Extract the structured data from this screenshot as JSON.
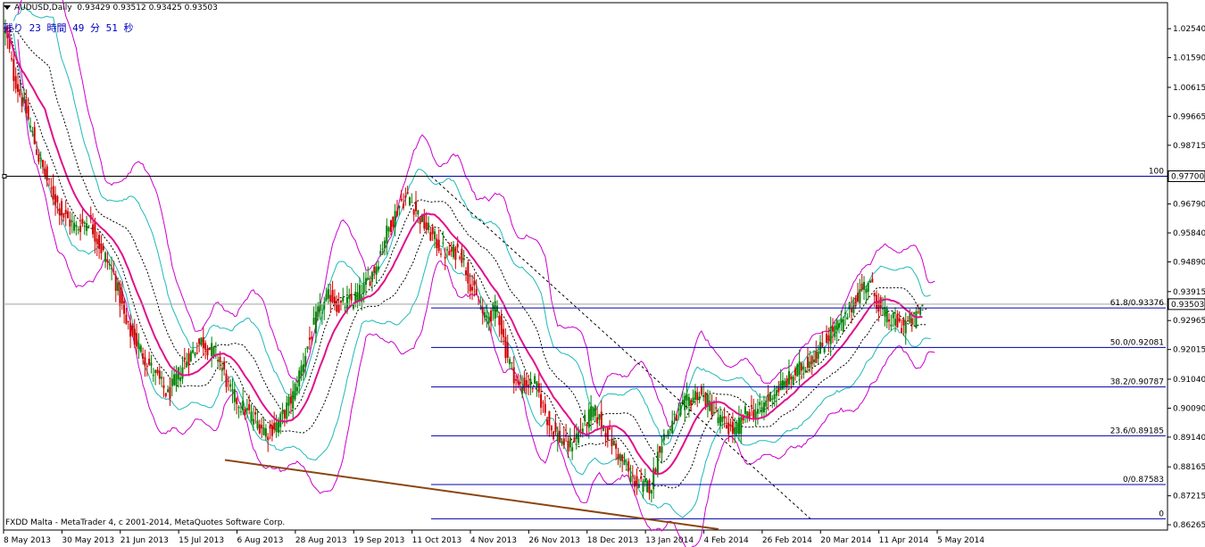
{
  "header": {
    "menu_icon": "triangle-down-icon",
    "symbol": "AUDUSD,Daily",
    "ohlc": "0.93429 0.93512 0.93425 0.93503",
    "timer": "残り 23 時間 49 分 51 秒"
  },
  "footer": {
    "copyright": "FXDD Malta - MetaTrader 4, c 2001-2014, MetaQuotes Software Corp."
  },
  "colors": {
    "background": "#ffffff",
    "bull_candle": "#008000",
    "bear_candle": "#d00000",
    "ma_line": "#e0108c",
    "outer_band": "#cc00cc",
    "inner_band": "#20b8b8",
    "envelope": "#000000",
    "fib_line": "#0000aa",
    "trendline": "#8b4513",
    "current_price": "#a0a0a0"
  },
  "chart_data": {
    "type": "candlestick",
    "symbol": "AUDUSD",
    "timeframe": "Daily",
    "last_price": 0.93503,
    "last_ohlc": {
      "open": 0.93429,
      "high": 0.93512,
      "low": 0.93425,
      "close": 0.93503
    },
    "y_range": [
      0.8615,
      1.0275
    ],
    "y_ticks": [
      "1.02540",
      "1.01590",
      "1.00615",
      "0.99665",
      "0.98715",
      "0.97700",
      "0.96790",
      "0.95840",
      "0.94890",
      "0.93915",
      "0.93503",
      "0.92965",
      "0.92015",
      "0.91040",
      "0.90090",
      "0.89140",
      "0.88165",
      "0.87215",
      "0.86265"
    ],
    "x_labels": [
      "8 May 2013",
      "30 May 2013",
      "21 Jun 2013",
      "15 Jul 2013",
      "6 Aug 2013",
      "28 Aug 2013",
      "19 Sep 2013",
      "11 Oct 2013",
      "4 Nov 2013",
      "26 Nov 2013",
      "18 Dec 2013",
      "13 Jan 2014",
      "4 Feb 2014",
      "26 Feb 2014",
      "20 Mar 2014",
      "11 Apr 2014",
      "5 May 2014"
    ],
    "horizontal_level": {
      "label": "0.97700",
      "value": 0.977
    },
    "fibonacci": [
      {
        "label": "100",
        "value": 0.977
      },
      {
        "label": "61.8/0.93376",
        "value": 0.93376
      },
      {
        "label": "50.0/0.92081",
        "value": 0.92081
      },
      {
        "label": "38.2/0.90787",
        "value": 0.90787
      },
      {
        "label": "23.6/0.89185",
        "value": 0.89185
      },
      {
        "label": "0/0.87583",
        "value": 0.87583
      },
      {
        "label": "0",
        "value": 0.8646
      }
    ],
    "close_keypoints": [
      [
        0,
        1.025
      ],
      [
        4,
        1.01
      ],
      [
        10,
        0.998
      ],
      [
        16,
        0.983
      ],
      [
        22,
        0.972
      ],
      [
        28,
        0.964
      ],
      [
        34,
        0.96
      ],
      [
        40,
        0.963
      ],
      [
        46,
        0.953
      ],
      [
        52,
        0.945
      ],
      [
        58,
        0.928
      ],
      [
        64,
        0.921
      ],
      [
        70,
        0.914
      ],
      [
        78,
        0.905
      ],
      [
        86,
        0.916
      ],
      [
        94,
        0.923
      ],
      [
        102,
        0.918
      ],
      [
        108,
        0.906
      ],
      [
        114,
        0.901
      ],
      [
        120,
        0.897
      ],
      [
        126,
        0.893
      ],
      [
        132,
        0.897
      ],
      [
        138,
        0.905
      ],
      [
        144,
        0.919
      ],
      [
        150,
        0.932
      ],
      [
        156,
        0.938
      ],
      [
        160,
        0.934
      ],
      [
        166,
        0.936
      ],
      [
        172,
        0.94
      ],
      [
        178,
        0.948
      ],
      [
        182,
        0.957
      ],
      [
        186,
        0.963
      ],
      [
        190,
        0.969
      ],
      [
        194,
        0.97
      ],
      [
        200,
        0.962
      ],
      [
        206,
        0.956
      ],
      [
        212,
        0.951
      ],
      [
        218,
        0.953
      ],
      [
        224,
        0.94
      ],
      [
        230,
        0.93
      ],
      [
        236,
        0.934
      ],
      [
        240,
        0.92
      ],
      [
        246,
        0.908
      ],
      [
        254,
        0.909
      ],
      [
        262,
        0.894
      ],
      [
        270,
        0.888
      ],
      [
        276,
        0.894
      ],
      [
        282,
        0.9
      ],
      [
        288,
        0.894
      ],
      [
        294,
        0.886
      ],
      [
        300,
        0.878
      ],
      [
        306,
        0.875
      ],
      [
        310,
        0.876
      ],
      [
        314,
        0.889
      ],
      [
        320,
        0.896
      ],
      [
        326,
        0.902
      ],
      [
        332,
        0.906
      ],
      [
        338,
        0.902
      ],
      [
        344,
        0.896
      ],
      [
        350,
        0.893
      ],
      [
        356,
        0.9
      ],
      [
        362,
        0.9
      ],
      [
        368,
        0.906
      ],
      [
        374,
        0.909
      ],
      [
        380,
        0.913
      ],
      [
        386,
        0.917
      ],
      [
        390,
        0.919
      ],
      [
        396,
        0.926
      ],
      [
        402,
        0.929
      ],
      [
        408,
        0.937
      ],
      [
        414,
        0.943
      ],
      [
        420,
        0.933
      ],
      [
        424,
        0.93
      ],
      [
        430,
        0.928
      ],
      [
        436,
        0.93
      ],
      [
        440,
        0.935
      ]
    ]
  }
}
